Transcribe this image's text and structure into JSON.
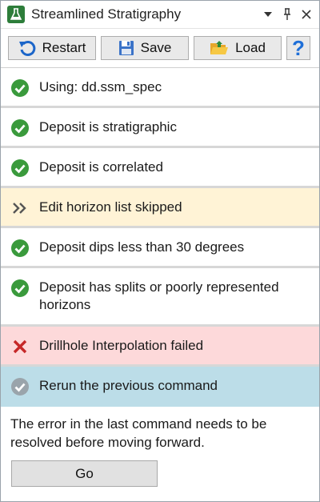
{
  "window": {
    "title": "Streamlined Stratigraphy",
    "controls": [
      "dropdown",
      "pin",
      "close"
    ]
  },
  "toolbar": {
    "restart_label": "Restart",
    "save_label": "Save",
    "load_label": "Load",
    "help_label": "?"
  },
  "steps": [
    {
      "label": "Using: dd.ssm_spec",
      "status": "done",
      "icon": "check-circle-icon"
    },
    {
      "label": "Deposit is stratigraphic",
      "status": "done",
      "icon": "check-circle-icon"
    },
    {
      "label": "Deposit is correlated",
      "status": "done",
      "icon": "check-circle-icon"
    },
    {
      "label": "Edit horizon list skipped",
      "status": "skipped",
      "icon": "double-chevron-icon"
    },
    {
      "label": "Deposit dips less than 30 degrees",
      "status": "done",
      "icon": "check-circle-icon"
    },
    {
      "label": "Deposit has splits or poorly represented horizons",
      "status": "done",
      "icon": "check-circle-icon"
    },
    {
      "label": "Drillhole Interpolation failed",
      "status": "failed",
      "icon": "x-mark-icon"
    },
    {
      "label": "Rerun the previous command",
      "status": "current",
      "icon": "check-circle-gray-icon"
    }
  ],
  "message": "The error in the last command needs to be resolved before moving forward.",
  "go_label": "Go",
  "colors": {
    "done": "#3a9a3c",
    "current": "#9aa4ab",
    "failed": "#c62828",
    "skipped_bg": "#fff3d6",
    "failed_bg": "#fdd9da",
    "current_bg": "#bcdde8",
    "help": "#1e6fd8"
  }
}
